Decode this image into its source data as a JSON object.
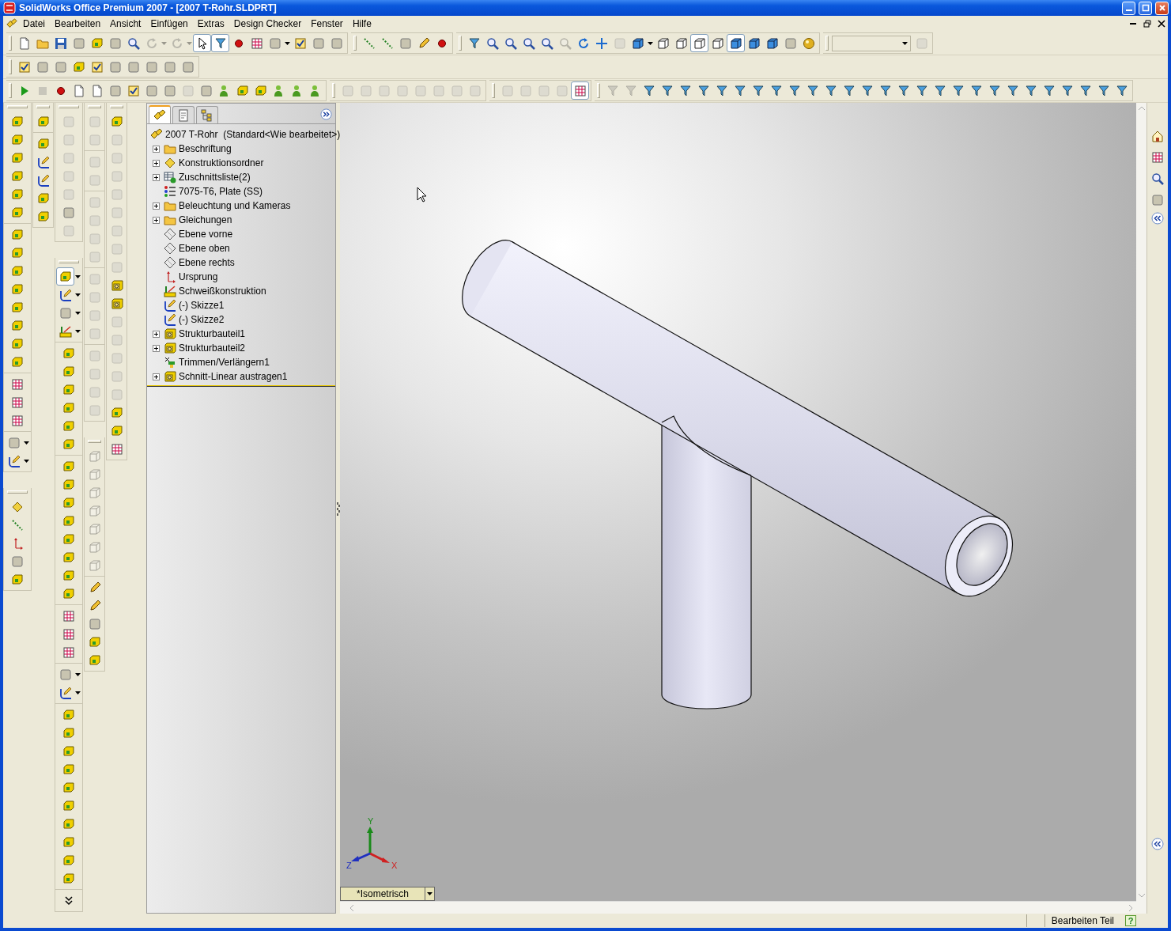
{
  "window": {
    "title": "SolidWorks Office Premium 2007 - [2007 T-Rohr.SLDPRT]"
  },
  "menu": [
    "Datei",
    "Bearbeiten",
    "Ansicht",
    "Einfügen",
    "Extras",
    "Design Checker",
    "Fenster",
    "Hilfe"
  ],
  "toolbar_rows": [
    [
      [
        {
          "kind": "page",
          "disabled": false,
          "pressed": false
        },
        {
          "kind": "folder",
          "disabled": false,
          "pressed": false
        },
        {
          "kind": "disk",
          "disabled": false,
          "pressed": false
        },
        {
          "kind": "tile",
          "disabled": false,
          "pressed": false
        },
        {
          "kind": "box",
          "disabled": false,
          "pressed": false
        },
        {
          "kind": "tile",
          "disabled": false,
          "pressed": false
        },
        {
          "kind": "magnifier",
          "disabled": false,
          "pressed": false
        },
        {
          "kind": "rotate",
          "disabled": true,
          "pressed": false
        },
        {
          "kind": "caret",
          "disabled": true,
          "pressed": false
        },
        {
          "kind": "rotate",
          "disabled": true,
          "pressed": false
        },
        {
          "kind": "caret",
          "disabled": true,
          "pressed": false
        },
        {
          "kind": "pointer",
          "disabled": false,
          "pressed": true
        },
        {
          "kind": "filter",
          "disabled": false,
          "pressed": true
        },
        {
          "kind": "dot",
          "disabled": false,
          "pressed": false
        },
        {
          "kind": "grid",
          "disabled": false,
          "pressed": false
        },
        {
          "kind": "tile",
          "disabled": false,
          "pressed": false
        },
        {
          "kind": "caret",
          "disabled": false,
          "pressed": false
        },
        {
          "kind": "check",
          "disabled": false,
          "pressed": false
        },
        {
          "kind": "tile",
          "disabled": false,
          "pressed": false
        },
        {
          "kind": "tile",
          "disabled": false,
          "pressed": false
        }
      ],
      [
        {
          "kind": "line",
          "disabled": false,
          "pressed": false
        },
        {
          "kind": "line",
          "disabled": false,
          "pressed": false
        },
        {
          "kind": "tile",
          "disabled": false,
          "pressed": false
        },
        {
          "kind": "pencil",
          "disabled": false,
          "pressed": false
        },
        {
          "kind": "dot",
          "disabled": false,
          "pressed": false
        }
      ],
      [
        {
          "kind": "filter",
          "disabled": false,
          "pressed": false
        },
        {
          "kind": "magnifier",
          "disabled": false,
          "pressed": false
        },
        {
          "kind": "magnifier",
          "disabled": false,
          "pressed": false
        },
        {
          "kind": "magnifier",
          "disabled": false,
          "pressed": false
        },
        {
          "kind": "magnifier",
          "disabled": false,
          "pressed": false
        },
        {
          "kind": "magnifier",
          "disabled": true,
          "pressed": false
        },
        {
          "kind": "rotate",
          "disabled": false,
          "pressed": false
        },
        {
          "kind": "move",
          "disabled": false,
          "pressed": false
        },
        {
          "kind": "tile",
          "disabled": true,
          "pressed": false
        },
        {
          "kind": "cube",
          "disabled": false,
          "pressed": false
        },
        {
          "kind": "caret",
          "disabled": false,
          "pressed": false
        },
        {
          "kind": "wirecube",
          "disabled": false,
          "pressed": false
        },
        {
          "kind": "wirecube",
          "disabled": false,
          "pressed": false
        },
        {
          "kind": "wirecube",
          "disabled": false,
          "pressed": true
        },
        {
          "kind": "wirecube",
          "disabled": false,
          "pressed": false
        },
        {
          "kind": "cube",
          "disabled": false,
          "pressed": true
        },
        {
          "kind": "cube",
          "disabled": false,
          "pressed": false
        },
        {
          "kind": "cube",
          "disabled": false,
          "pressed": false
        },
        {
          "kind": "tile",
          "disabled": false,
          "pressed": false
        },
        {
          "kind": "sphere",
          "disabled": false,
          "pressed": false
        }
      ],
      [
        {
          "kind": "combo",
          "disabled": true,
          "pressed": false
        },
        {
          "kind": "tile",
          "disabled": true,
          "pressed": false
        }
      ]
    ],
    [
      [
        {
          "kind": "check",
          "disabled": false,
          "pressed": false
        },
        {
          "kind": "tile",
          "disabled": false,
          "pressed": false
        },
        {
          "kind": "tile",
          "disabled": false,
          "pressed": false
        },
        {
          "kind": "box",
          "disabled": false,
          "pressed": false
        },
        {
          "kind": "check",
          "disabled": false,
          "pressed": false
        },
        {
          "kind": "tile",
          "disabled": false,
          "pressed": false
        },
        {
          "kind": "tile",
          "disabled": false,
          "pressed": false
        },
        {
          "kind": "tile",
          "disabled": false,
          "pressed": false
        },
        {
          "kind": "tile",
          "disabled": false,
          "pressed": false
        },
        {
          "kind": "tile",
          "disabled": false,
          "pressed": false
        }
      ]
    ],
    [
      [
        {
          "kind": "play",
          "disabled": false,
          "pressed": false
        },
        {
          "kind": "stop",
          "disabled": true,
          "pressed": false
        },
        {
          "kind": "dot",
          "disabled": false,
          "pressed": false
        },
        {
          "kind": "page",
          "disabled": false,
          "pressed": false
        },
        {
          "kind": "page",
          "disabled": false,
          "pressed": false
        },
        {
          "kind": "tile",
          "disabled": false,
          "pressed": false
        },
        {
          "kind": "check",
          "disabled": false,
          "pressed": false
        },
        {
          "kind": "tile",
          "disabled": false,
          "pressed": false
        },
        {
          "kind": "tile",
          "disabled": false,
          "pressed": false
        },
        {
          "kind": "tile",
          "disabled": true,
          "pressed": false
        },
        {
          "kind": "tile",
          "disabled": false,
          "pressed": false
        },
        {
          "kind": "person",
          "disabled": false,
          "pressed": false
        },
        {
          "kind": "box",
          "disabled": false,
          "pressed": false
        },
        {
          "kind": "box",
          "disabled": false,
          "pressed": false
        },
        {
          "kind": "person",
          "disabled": false,
          "pressed": false
        },
        {
          "kind": "person",
          "disabled": false,
          "pressed": false
        },
        {
          "kind": "person",
          "disabled": false,
          "pressed": false
        }
      ],
      [
        {
          "kind": "tile",
          "disabled": true,
          "pressed": false
        },
        {
          "kind": "tile",
          "disabled": true,
          "pressed": false
        },
        {
          "kind": "tile",
          "disabled": true,
          "pressed": false
        },
        {
          "kind": "tile",
          "disabled": true,
          "pressed": false
        },
        {
          "kind": "tile",
          "disabled": true,
          "pressed": false
        },
        {
          "kind": "tile",
          "disabled": true,
          "pressed": false
        },
        {
          "kind": "tile",
          "disabled": true,
          "pressed": false
        },
        {
          "kind": "tile",
          "disabled": true,
          "pressed": false
        }
      ],
      [
        {
          "kind": "tile",
          "disabled": true,
          "pressed": false
        },
        {
          "kind": "tile",
          "disabled": true,
          "pressed": false
        },
        {
          "kind": "tile",
          "disabled": true,
          "pressed": false
        },
        {
          "kind": "tile",
          "disabled": true,
          "pressed": false
        },
        {
          "kind": "grid",
          "disabled": false,
          "pressed": true
        }
      ],
      [
        {
          "kind": "filter",
          "disabled": true,
          "pressed": false
        },
        {
          "kind": "filter",
          "disabled": true,
          "pressed": false
        },
        {
          "kind": "filter",
          "disabled": false,
          "pressed": false
        },
        {
          "kind": "filter",
          "disabled": false,
          "pressed": false
        },
        {
          "kind": "filter",
          "disabled": false,
          "pressed": false
        },
        {
          "kind": "filter",
          "disabled": false,
          "pressed": false
        },
        {
          "kind": "filter",
          "disabled": false,
          "pressed": false
        },
        {
          "kind": "filter",
          "disabled": false,
          "pressed": false
        },
        {
          "kind": "filter",
          "disabled": false,
          "pressed": false
        },
        {
          "kind": "filter",
          "disabled": false,
          "pressed": false
        },
        {
          "kind": "filter",
          "disabled": false,
          "pressed": false
        },
        {
          "kind": "filter",
          "disabled": false,
          "pressed": false
        },
        {
          "kind": "filter",
          "disabled": false,
          "pressed": false
        },
        {
          "kind": "filter",
          "disabled": false,
          "pressed": false
        },
        {
          "kind": "filter",
          "disabled": false,
          "pressed": false
        },
        {
          "kind": "filter",
          "disabled": false,
          "pressed": false
        },
        {
          "kind": "filter",
          "disabled": false,
          "pressed": false
        },
        {
          "kind": "filter",
          "disabled": false,
          "pressed": false
        },
        {
          "kind": "filter",
          "disabled": false,
          "pressed": false
        },
        {
          "kind": "filter",
          "disabled": false,
          "pressed": false
        },
        {
          "kind": "filter",
          "disabled": false,
          "pressed": false
        },
        {
          "kind": "filter",
          "disabled": false,
          "pressed": false
        },
        {
          "kind": "filter",
          "disabled": false,
          "pressed": false
        },
        {
          "kind": "filter",
          "disabled": false,
          "pressed": false
        },
        {
          "kind": "filter",
          "disabled": false,
          "pressed": false
        },
        {
          "kind": "filter",
          "disabled": false,
          "pressed": false
        },
        {
          "kind": "filter",
          "disabled": false,
          "pressed": false
        },
        {
          "kind": "filter",
          "disabled": false,
          "pressed": false
        },
        {
          "kind": "filter",
          "disabled": false,
          "pressed": false
        }
      ]
    ]
  ],
  "side_toolbars": [
    [
      [
        [
          {
            "kind": "box",
            "disabled": false,
            "pressed": false
          },
          {
            "kind": "box",
            "disabled": false,
            "pressed": false
          },
          {
            "kind": "box",
            "disabled": false,
            "pressed": false
          },
          {
            "kind": "box",
            "disabled": false,
            "pressed": false
          },
          {
            "kind": "box",
            "disabled": false,
            "pressed": false
          },
          {
            "kind": "box",
            "disabled": false,
            "pressed": false
          }
        ],
        [
          {
            "kind": "box",
            "disabled": false,
            "pressed": false
          },
          {
            "kind": "box",
            "disabled": false,
            "pressed": false
          },
          {
            "kind": "box",
            "disabled": false,
            "pressed": false
          },
          {
            "kind": "box",
            "disabled": false,
            "pressed": false
          },
          {
            "kind": "box",
            "disabled": false,
            "pressed": false
          },
          {
            "kind": "box",
            "disabled": false,
            "pressed": false
          },
          {
            "kind": "box",
            "disabled": false,
            "pressed": false
          },
          {
            "kind": "box",
            "disabled": false,
            "pressed": false
          }
        ],
        [
          {
            "kind": "grid",
            "disabled": false,
            "pressed": false
          },
          {
            "kind": "grid",
            "disabled": false,
            "pressed": false
          },
          {
            "kind": "grid",
            "disabled": false,
            "pressed": false
          }
        ],
        [
          {
            "kind": "tile",
            "disabled": false,
            "pressed": false
          },
          {
            "kind": "caret",
            "disabled": false,
            "pressed": false
          },
          {
            "kind": "sketch",
            "disabled": false,
            "pressed": false
          },
          {
            "kind": "caret",
            "disabled": false,
            "pressed": false
          }
        ]
      ],
      [
        [
          {
            "kind": "diamond",
            "disabled": false,
            "pressed": false
          },
          {
            "kind": "line",
            "disabled": false,
            "pressed": false
          },
          {
            "kind": "origin",
            "disabled": false,
            "pressed": false
          },
          {
            "kind": "tile",
            "disabled": false,
            "pressed": false
          },
          {
            "kind": "box",
            "disabled": false,
            "pressed": false
          }
        ]
      ]
    ],
    [
      [
        [
          {
            "kind": "box",
            "disabled": false,
            "pressed": false
          }
        ],
        [
          {
            "kind": "box",
            "disabled": false,
            "pressed": false
          },
          {
            "kind": "sketch",
            "disabled": false,
            "pressed": false
          },
          {
            "kind": "sketch",
            "disabled": false,
            "pressed": false
          },
          {
            "kind": "box",
            "disabled": false,
            "pressed": false
          },
          {
            "kind": "box",
            "disabled": false,
            "pressed": false
          }
        ]
      ]
    ],
    [
      [
        [
          {
            "kind": "tile",
            "disabled": true,
            "pressed": false
          },
          {
            "kind": "tile",
            "disabled": true,
            "pressed": false
          },
          {
            "kind": "tile",
            "disabled": true,
            "pressed": false
          },
          {
            "kind": "tile",
            "disabled": true,
            "pressed": false
          },
          {
            "kind": "tile",
            "disabled": true,
            "pressed": false
          },
          {
            "kind": "tile",
            "disabled": false,
            "pressed": false
          },
          {
            "kind": "tile",
            "disabled": true,
            "pressed": false
          }
        ]
      ],
      [
        [
          {
            "kind": "box",
            "disabled": false,
            "pressed": true
          },
          {
            "kind": "caret",
            "disabled": false,
            "pressed": false
          },
          {
            "kind": "sketch",
            "disabled": false,
            "pressed": false
          },
          {
            "kind": "caret",
            "disabled": false,
            "pressed": false
          },
          {
            "kind": "tile",
            "disabled": false,
            "pressed": false
          },
          {
            "kind": "caret",
            "disabled": false,
            "pressed": false
          },
          {
            "kind": "weld",
            "disabled": false,
            "pressed": false
          },
          {
            "kind": "caret",
            "disabled": false,
            "pressed": false
          }
        ],
        [
          {
            "kind": "box",
            "disabled": false,
            "pressed": false
          },
          {
            "kind": "box",
            "disabled": false,
            "pressed": false
          },
          {
            "kind": "box",
            "disabled": false,
            "pressed": false
          },
          {
            "kind": "box",
            "disabled": false,
            "pressed": false
          },
          {
            "kind": "box",
            "disabled": false,
            "pressed": false
          },
          {
            "kind": "box",
            "disabled": false,
            "pressed": false
          }
        ],
        [
          {
            "kind": "box",
            "disabled": false,
            "pressed": false
          },
          {
            "kind": "box",
            "disabled": false,
            "pressed": false
          },
          {
            "kind": "box",
            "disabled": false,
            "pressed": false
          },
          {
            "kind": "box",
            "disabled": false,
            "pressed": false
          },
          {
            "kind": "box",
            "disabled": false,
            "pressed": false
          },
          {
            "kind": "box",
            "disabled": false,
            "pressed": false
          },
          {
            "kind": "box",
            "disabled": false,
            "pressed": false
          },
          {
            "kind": "box",
            "disabled": false,
            "pressed": false
          }
        ],
        [
          {
            "kind": "grid",
            "disabled": false,
            "pressed": false
          },
          {
            "kind": "grid",
            "disabled": false,
            "pressed": false
          },
          {
            "kind": "grid",
            "disabled": false,
            "pressed": false
          }
        ],
        [
          {
            "kind": "tile",
            "disabled": false,
            "pressed": false
          },
          {
            "kind": "caret",
            "disabled": false,
            "pressed": false
          },
          {
            "kind": "sketch",
            "disabled": false,
            "pressed": false
          },
          {
            "kind": "caret",
            "disabled": false,
            "pressed": false
          }
        ],
        [
          {
            "kind": "box",
            "disabled": false,
            "pressed": false
          },
          {
            "kind": "box",
            "disabled": false,
            "pressed": false
          },
          {
            "kind": "box",
            "disabled": false,
            "pressed": false
          },
          {
            "kind": "box",
            "disabled": false,
            "pressed": false
          },
          {
            "kind": "box",
            "disabled": false,
            "pressed": false
          },
          {
            "kind": "box",
            "disabled": false,
            "pressed": false
          },
          {
            "kind": "box",
            "disabled": false,
            "pressed": false
          },
          {
            "kind": "box",
            "disabled": false,
            "pressed": false
          },
          {
            "kind": "box",
            "disabled": false,
            "pressed": false
          },
          {
            "kind": "box",
            "disabled": false,
            "pressed": false
          }
        ],
        [
          {
            "kind": "chevrons",
            "disabled": false,
            "pressed": false
          }
        ]
      ]
    ],
    [
      [
        [
          {
            "kind": "tile",
            "disabled": true,
            "pressed": false
          },
          {
            "kind": "tile",
            "disabled": true,
            "pressed": false
          }
        ],
        [
          {
            "kind": "tile",
            "disabled": true,
            "pressed": false
          },
          {
            "kind": "tile",
            "disabled": true,
            "pressed": false
          }
        ],
        [
          {
            "kind": "tile",
            "disabled": true,
            "pressed": false
          },
          {
            "kind": "tile",
            "disabled": true,
            "pressed": false
          },
          {
            "kind": "tile",
            "disabled": true,
            "pressed": false
          },
          {
            "kind": "tile",
            "disabled": true,
            "pressed": false
          }
        ],
        [
          {
            "kind": "tile",
            "disabled": true,
            "pressed": false
          },
          {
            "kind": "tile",
            "disabled": true,
            "pressed": false
          },
          {
            "kind": "tile",
            "disabled": true,
            "pressed": false
          },
          {
            "kind": "tile",
            "disabled": true,
            "pressed": false
          }
        ],
        [
          {
            "kind": "tile",
            "disabled": true,
            "pressed": false
          },
          {
            "kind": "tile",
            "disabled": true,
            "pressed": false
          },
          {
            "kind": "tile",
            "disabled": true,
            "pressed": false
          },
          {
            "kind": "tile",
            "disabled": true,
            "pressed": false
          }
        ]
      ],
      [
        [
          {
            "kind": "wirecube",
            "disabled": true,
            "pressed": false
          },
          {
            "kind": "wirecube",
            "disabled": true,
            "pressed": false
          },
          {
            "kind": "wirecube",
            "disabled": true,
            "pressed": false
          },
          {
            "kind": "wirecube",
            "disabled": true,
            "pressed": false
          },
          {
            "kind": "wirecube",
            "disabled": true,
            "pressed": false
          },
          {
            "kind": "wirecube",
            "disabled": true,
            "pressed": false
          },
          {
            "kind": "wirecube",
            "disabled": true,
            "pressed": false
          }
        ],
        [
          {
            "kind": "pencil",
            "disabled": false,
            "pressed": false
          },
          {
            "kind": "pencil",
            "disabled": false,
            "pressed": false
          },
          {
            "kind": "tile",
            "disabled": false,
            "pressed": false
          },
          {
            "kind": "box",
            "disabled": false,
            "pressed": false
          },
          {
            "kind": "box",
            "disabled": false,
            "pressed": false
          }
        ]
      ]
    ],
    [
      [
        [
          {
            "kind": "box",
            "disabled": false,
            "pressed": false
          },
          {
            "kind": "tile",
            "disabled": true,
            "pressed": false
          },
          {
            "kind": "tile",
            "disabled": true,
            "pressed": false
          },
          {
            "kind": "tile",
            "disabled": true,
            "pressed": false
          },
          {
            "kind": "tile",
            "disabled": true,
            "pressed": false
          },
          {
            "kind": "tile",
            "disabled": true,
            "pressed": false
          },
          {
            "kind": "tile",
            "disabled": true,
            "pressed": false
          },
          {
            "kind": "tile",
            "disabled": true,
            "pressed": false
          },
          {
            "kind": "tile",
            "disabled": true,
            "pressed": false
          },
          {
            "kind": "member",
            "disabled": false,
            "pressed": false
          },
          {
            "kind": "member",
            "disabled": false,
            "pressed": false
          },
          {
            "kind": "tile",
            "disabled": true,
            "pressed": false
          },
          {
            "kind": "tile",
            "disabled": true,
            "pressed": false
          },
          {
            "kind": "tile",
            "disabled": true,
            "pressed": false
          },
          {
            "kind": "tile",
            "disabled": true,
            "pressed": false
          },
          {
            "kind": "tile",
            "disabled": true,
            "pressed": false
          },
          {
            "kind": "box",
            "disabled": false,
            "pressed": false
          },
          {
            "kind": "box",
            "disabled": false,
            "pressed": false
          },
          {
            "kind": "grid",
            "disabled": false,
            "pressed": false
          }
        ]
      ]
    ]
  ],
  "feature_tree": {
    "tabs": [
      {
        "kind": "parts",
        "selected": true
      },
      {
        "kind": "sheet",
        "selected": false
      },
      {
        "kind": "hierarchy",
        "selected": false
      }
    ],
    "root": {
      "label": "2007 T-Rohr  (Standard<Wie bearbeitet>)"
    },
    "items": [
      {
        "label": "Beschriftung",
        "kind": "folder",
        "expandable": true
      },
      {
        "label": "Konstruktionsordner",
        "kind": "diamond",
        "expandable": true
      },
      {
        "label": "Zuschnittsliste(2)",
        "kind": "table",
        "expandable": true
      },
      {
        "label": "7075-T6, Plate (SS)",
        "kind": "list",
        "expandable": false
      },
      {
        "label": "Beleuchtung und Kameras",
        "kind": "folder",
        "expandable": true
      },
      {
        "label": "Gleichungen",
        "kind": "folder",
        "expandable": true
      },
      {
        "label": "Ebene vorne",
        "kind": "plane",
        "expandable": false
      },
      {
        "label": "Ebene oben",
        "kind": "plane",
        "expandable": false
      },
      {
        "label": "Ebene rechts",
        "kind": "plane",
        "expandable": false
      },
      {
        "label": "Ursprung",
        "kind": "origin",
        "expandable": false
      },
      {
        "label": "Schweißkonstruktion",
        "kind": "weld",
        "expandable": false
      },
      {
        "label": "(-) Skizze1",
        "kind": "sketch",
        "expandable": false
      },
      {
        "label": "(-) Skizze2",
        "kind": "sketch",
        "expandable": false
      },
      {
        "label": "Strukturbauteil1",
        "kind": "member",
        "expandable": true
      },
      {
        "label": "Strukturbauteil2",
        "kind": "member",
        "expandable": true
      },
      {
        "label": "Trimmen/Verlängern1",
        "kind": "trim",
        "expandable": false
      },
      {
        "label": "Schnitt-Linear austragen1",
        "kind": "member",
        "expandable": true
      }
    ]
  },
  "viewport": {
    "view_name": "*Isometrisch",
    "triad_labels": [
      "Y",
      "Z",
      "X"
    ]
  },
  "task_pane": {
    "items": [
      {
        "kind": "house"
      },
      {
        "kind": "grid"
      },
      {
        "kind": "magnifier"
      },
      {
        "kind": "tile"
      }
    ]
  },
  "status_bar": {
    "mode": "Bearbeiten Teil",
    "help": "?"
  }
}
